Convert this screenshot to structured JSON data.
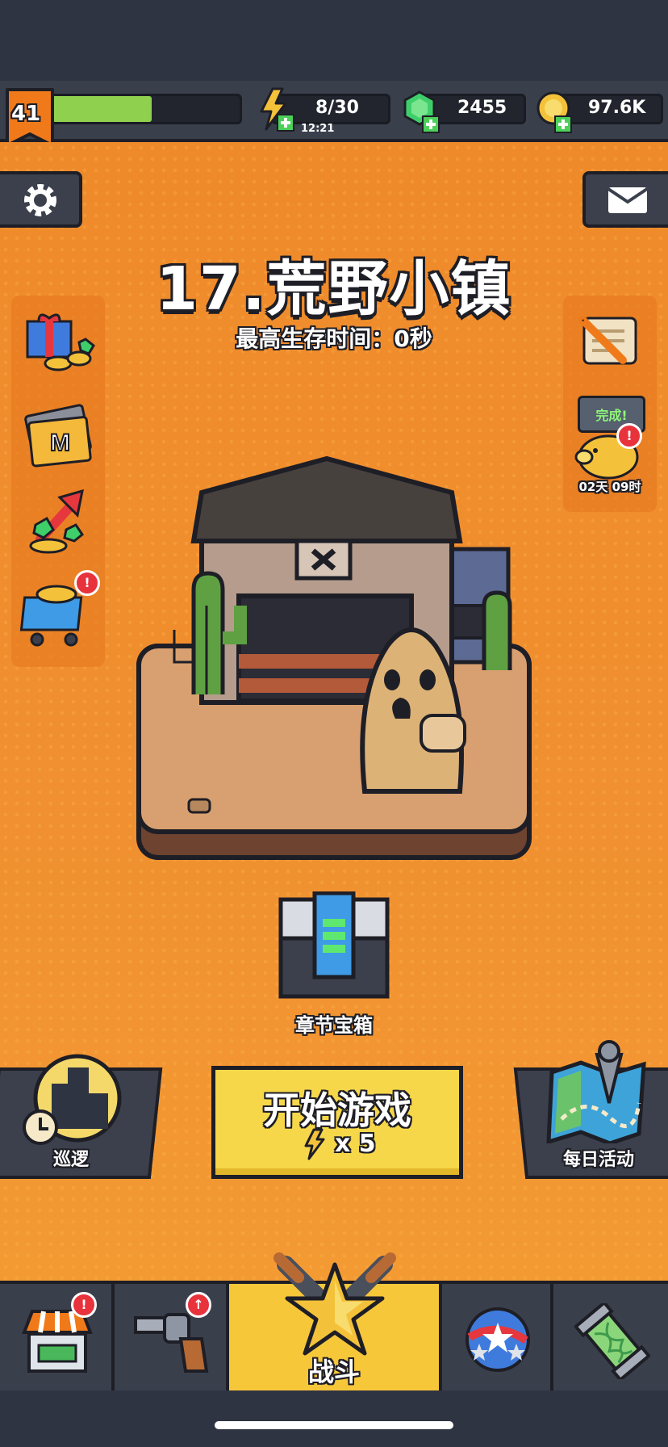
{
  "player": {
    "level": "41",
    "xp_progress": 0.53
  },
  "energy": {
    "value": "8/30",
    "timer": "12:21"
  },
  "gems": {
    "value": "2455"
  },
  "coins": {
    "value": "97.6K"
  },
  "stage": {
    "title": "17.荒野小镇",
    "subtitle": "最高生存时间：0秒"
  },
  "right_panel": {
    "complete_label": "完成!",
    "piggy_timer": "02天 09时"
  },
  "chest": {
    "label": "章节宝箱"
  },
  "patrol": {
    "label": "巡逻"
  },
  "daily": {
    "label": "每日活动"
  },
  "start_button": {
    "label": "开始游戏",
    "cost": "x 5"
  },
  "bottom_nav": {
    "battle_label": "战斗"
  },
  "colors": {
    "orange_bg": "#f09030",
    "xp_bar": "#8fd14f",
    "start_button": "#f7d74a",
    "badge": "#e8323c"
  }
}
